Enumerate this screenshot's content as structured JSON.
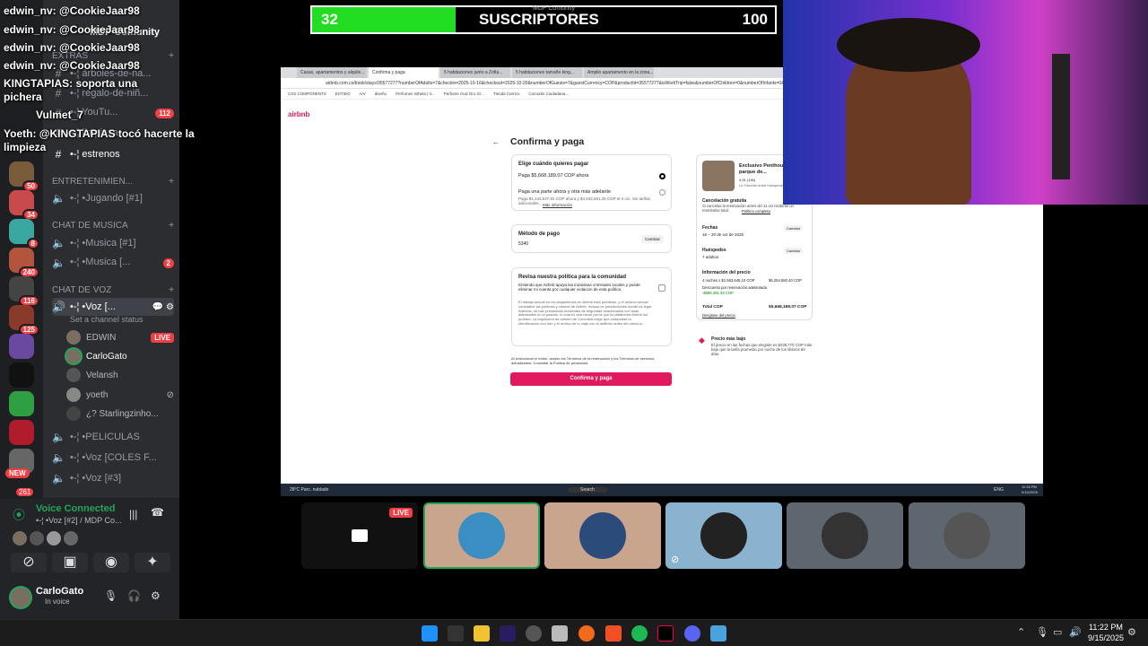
{
  "chat_overlay": [
    "edwin_nv: @CookieJaar98",
    "edwin_nv: @CookieJaar98",
    "edwin_nv: @CookieJaar98",
    "edwin_nv: @CookieJaar98",
    "KINGTAPIAS: soporta una",
    "pichera",
    "Vulmet_7",
    "Yoeth: @KINGTAPIAS tocó hacerte la",
    "limpieza"
  ],
  "channels": {
    "server_name": "MDP Comunity",
    "cat_extras": "EXTRAS",
    "ch_arboles": "•-¦ árboles-de-na...",
    "ch_regalo": "•-¦ regalo-de-niñ...",
    "ch_youtube": "•-¦ YouTu...",
    "youtube_badge": "112",
    "ch_limpieza": "•-¦ limpieza",
    "ch_estrenos": "•-¦ estrenos",
    "cat_entretenimiento": "ENTRETENIMIEN...",
    "ch_jugando": "•-¦ •Jugando [#1]",
    "cat_musica": "CHAT DE MUSICA",
    "ch_musica1": "•-¦ •Musica [#1]",
    "ch_musica2": "•-¦ •Musica [...",
    "musica2_badge": "2",
    "cat_voz": "CHAT DE VOZ",
    "ch_voz_active": "•-¦ •Voz [...",
    "channel_status": "Set a channel status",
    "voice_users": [
      "EDWIN",
      "CarloGato",
      "Velansh",
      "yoeth",
      "¿? Starlingzinho..."
    ],
    "live_label": "LIVE",
    "ch_peliculas": "•-¦ •PELICULAS",
    "ch_voz_coles": "•-¦ •Voz [COLES F...",
    "ch_voz3": "•-¦ •Voz [#3]"
  },
  "rail_badges": [
    "50",
    "34",
    "8",
    "240",
    "116",
    "125",
    "NEW",
    "261"
  ],
  "voice_panel": {
    "status": "Voice Connected",
    "channel": "•-¦ •Voz [#2] / MDP Co..."
  },
  "user_panel": {
    "name": "CarloGato",
    "status": "In voice"
  },
  "stream_header": {
    "left_count": "32",
    "title": "SUSCRIPTORES",
    "right_count": "100",
    "overlay_small": "MDP Comunity"
  },
  "browser": {
    "tabs": [
      "Casas, apartamentos y alquile...",
      "Confirma y paga",
      "5 habitaciones junto a Zofia...",
      "5 habitaciones tamaño king...",
      "Amplio apartamento en la zona..."
    ],
    "url": "airbnb.com.co/book/stays/35577277?numberOfAdults=7&checkin=2025-10-16&checkout=2025-10-20&numberOfGuests=7&guestCurrency=COP&productId=35577277&isWorkTrip=false&numberOfChildren=0&numberOfInfants=0&numberOfPets",
    "bookmarks": [
      "CSS COMPONENTS",
      "ESTIDO",
      "A/V",
      "diseño",
      "Perfumes Isthela | Ir...",
      "Perfume Oud Oro Gr...",
      "Tienda Carrizo",
      "Comodin Ciudadana..."
    ]
  },
  "airbnb": {
    "logo": "airbnb",
    "heading": "Confirma y paga",
    "pay_title": "Elige cuándo quieres pagar",
    "pay_now": "Paga $5,668,189.07 COP ahora",
    "pay_partial": "Paga una parte ahora y otra más adelante",
    "pay_partial_detail": "Paga $1,133,637.81 COP ahora y $4,534,551.25 COP el 3 oct. Sin tarifas adicionales.",
    "more_info": "Más información",
    "method_title": "Método de pago",
    "method_card": "5340",
    "change": "Cambiar",
    "policy_title": "Revisa nuestra política para la comunidad",
    "policy_text": "Entiendo que Airbnb apoya las iniciativas criminales locales y puede eliminar mi cuenta por cualquier violación de esta política.",
    "policy_body": "El trabajo sexual en los alojamientos en Airbnb está prohibido, y el turismo sexual contradice las políticas y valores de Airbnb, incluso en jurisdicciones donde es legal. Además, se han presentado incidentes de seguridad relacionados con esas actividades en el pasado, lo cual es otra razón por la que la plataforma Airbnb los prohíbe. La regulación de turismo de Colombia exige que compartas tu identificación con foto y el motivo de tu viaje con el anfitrión antes del check-in.",
    "terms": "Al seleccionar el botón, acepto los Términos de la reservación y los Términos de servicios actualizados. Consultar la Política de privacidad.",
    "confirm_button": "Confirma y paga",
    "listing_title": "Exclusivo Penthouse cerca al parque de...",
    "listing_rating": "4.91 (190)",
    "listing_sub": "Le Favorito entre huéspedes",
    "cancel_title": "Cancelación gratuita",
    "cancel_text": "Si cancelas la reservación antes del 11 oct recibirás un reembolso total.",
    "cancel_link": "Política completa",
    "dates_label": "Fechas",
    "dates_value": "16 – 20 de oct de 2025",
    "guests_label": "Huéspedes",
    "guests_value": "7 adultos",
    "price_info": "Información del precio",
    "nights_line": "4 noches x $1,563,645.10 COP",
    "nights_total": "$6,254,580.40 COP",
    "discount_line": "Descuento por reservación adelantada",
    "discount_value": "-$586,391.33 COP",
    "total_label": "Total COP",
    "total_value": "$5,668,189.07 COP",
    "breakdown": "Desglose del precio",
    "low_price_title": "Precio más bajo",
    "low_price_text": "El precio en las fechas que elegiste es $438,770 COP más bajo que la tarifa promedio por noche de los últimos 60 días."
  },
  "inner_taskbar": {
    "weather": "28°C Parc. nublado",
    "search": "Search",
    "lang": "ENG",
    "time": "11:26 PM",
    "date": "9/15/2025"
  },
  "participants_live": "LIVE",
  "taskbar": {
    "time": "11:22 PM",
    "date": "9/15/2025"
  },
  "colors": {
    "discord_bg": "#2b2d31",
    "rail_bg": "#1e1f22",
    "airbnb_brand": "#e1195f",
    "progress_green": "#22dd22",
    "live_red": "#f23f43",
    "voice_green": "#23a55a"
  }
}
